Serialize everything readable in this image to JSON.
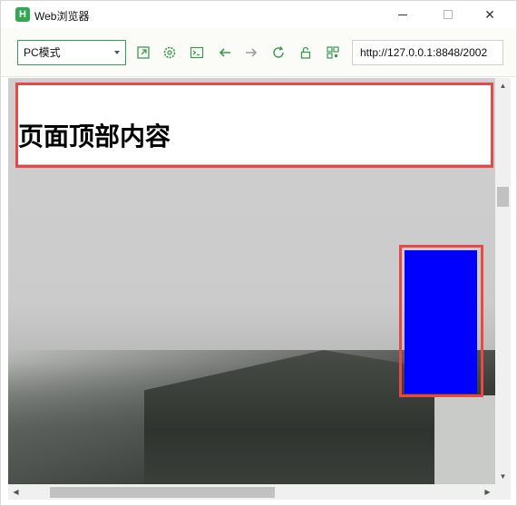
{
  "window": {
    "title": "Web浏览器",
    "app_icon_letter": "H"
  },
  "toolbar": {
    "mode_select_value": "PC模式",
    "url": "http://127.0.0.1:8848/2002",
    "icons": [
      "open-external-icon",
      "settings-icon",
      "console-icon",
      "back-icon",
      "forward-icon",
      "refresh-icon",
      "unlock-icon",
      "qrcode-icon"
    ]
  },
  "page": {
    "header_text": "页面顶部内容",
    "blue_box_color": "#0000ff",
    "outline_color": "#e84848"
  },
  "colors": {
    "accent": "#3a9a52"
  }
}
